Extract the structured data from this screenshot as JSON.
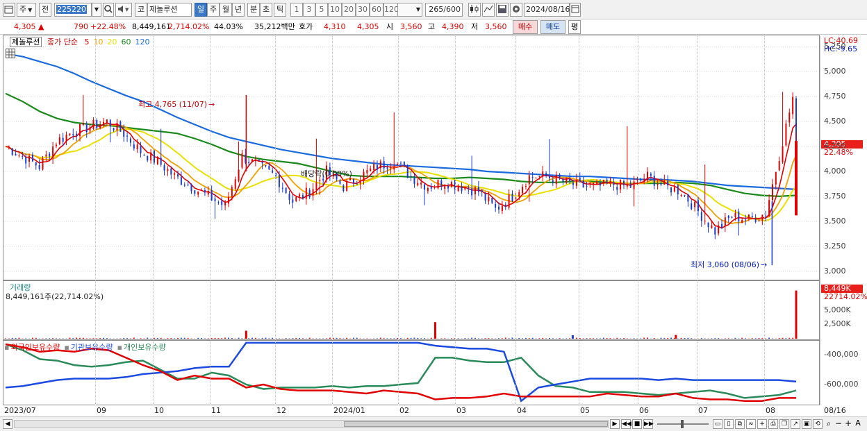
{
  "toolbar": {
    "period_type": "주",
    "prev_label": "전",
    "code_value": "225220",
    "market_label": "코",
    "stock_name": "제놀루션",
    "periods": [
      {
        "label": "일",
        "selected": true
      },
      {
        "label": "주",
        "selected": false
      },
      {
        "label": "월",
        "selected": false
      },
      {
        "label": "년",
        "selected": false
      },
      {
        "label": "분",
        "selected": false
      },
      {
        "label": "초",
        "selected": false
      },
      {
        "label": "틱",
        "selected": false
      }
    ],
    "intervals": [
      "1",
      "3",
      "5",
      "10",
      "20",
      "30",
      "60",
      "120"
    ],
    "count_value": "265",
    "count_total": "/600",
    "date_value": "2024/08/16"
  },
  "quote": {
    "price": "4,305",
    "up_arrow": "▲",
    "change": "790",
    "change_pct": "+22.48%",
    "volume": "8,449,161",
    "volume_ratio": "2,714.02%",
    "turnover": "44.03%",
    "amount": "35,212백만",
    "bid_label": "호가",
    "bid_value": "4,310",
    "ask_value": "4,305",
    "open_label": "시",
    "open_value": "3,560",
    "high_label": "고",
    "high_value": "4,390",
    "low_label": "저",
    "low_value": "3,560",
    "buy_label": "매수",
    "sell_label": "매도",
    "eval_label": "평"
  },
  "price_panel": {
    "stock_label": "제놀루션",
    "ma_type": "종가 단순",
    "ma_periods": [
      {
        "label": "5",
        "color": "#e00000"
      },
      {
        "label": "10",
        "color": "#f0a000"
      },
      {
        "label": "20",
        "color": "#e8e000"
      },
      {
        "label": "60",
        "color": "#1a8a1a"
      },
      {
        "label": "120",
        "color": "#1a6ae0"
      }
    ],
    "lc_label": "LC:40.69",
    "hc_label": "HC:-9.65",
    "price_badge": "4,305",
    "pct_label": "22.48%",
    "high_annotation": "최고 4,765 (11/07)",
    "low_annotation": "최저 3,060 (08/06)",
    "dividend_annotation": "배당락(0.00%)",
    "y_labels": [
      "5,250",
      "5,000",
      "4,750",
      "4,500",
      "4,250",
      "4,000",
      "3,750",
      "3,500",
      "3,250",
      "3,000"
    ]
  },
  "volume_panel": {
    "title": "거래량",
    "value_text": "8,449,161주(22,714.02%)",
    "badge": "8,449K",
    "pct_label": "22714.02%",
    "y_labels": [
      "5,000K",
      "2,500K"
    ]
  },
  "holding_panel": {
    "legend": [
      {
        "label": "외국인보유수량",
        "color": "#e00000"
      },
      {
        "label": "기관보유수량",
        "color": "#1a4ae0"
      },
      {
        "label": "개인보유수량",
        "color": "#2a8a5a"
      }
    ],
    "y_labels": [
      "-400,000",
      "-600,000"
    ]
  },
  "x_axis": {
    "labels": [
      "2023/07",
      "09",
      "10",
      "11",
      "12",
      "2024/01",
      "02",
      "03",
      "04",
      "05",
      "06",
      "07",
      "08",
      "08/16"
    ]
  },
  "chart_data": {
    "type": "candlestick",
    "price_axis": {
      "ylim": [
        2950,
        5300
      ]
    },
    "weekly_close": [
      4250,
      4150,
      4050,
      4300,
      4400,
      4450,
      4500,
      4380,
      4200,
      4100,
      3950,
      3850,
      3750,
      3650,
      4150,
      4050,
      3950,
      3700,
      3800,
      4000,
      3850,
      3950,
      4050,
      4100,
      3950,
      3850,
      3900,
      3850,
      3800,
      3620,
      3750,
      3950,
      3950,
      3900,
      3850,
      3850,
      3870,
      3850,
      3950,
      3850,
      3800,
      3600,
      3400,
      3550,
      3520,
      3580,
      4305
    ],
    "ma120": [
      5180,
      5150,
      5100,
      5050,
      4980,
      4900,
      4830,
      4760,
      4700,
      4620,
      4540,
      4470,
      4400,
      4340,
      4300,
      4260,
      4220,
      4190,
      4160,
      4130,
      4110,
      4090,
      4070,
      4060,
      4050,
      4040,
      4030,
      4020,
      4000,
      3990,
      3980,
      3970,
      3960,
      3950,
      3950,
      3940,
      3930,
      3920,
      3920,
      3910,
      3900,
      3880,
      3860,
      3850,
      3840,
      3830,
      3820
    ],
    "ma60": [
      4780,
      4700,
      4600,
      4530,
      4490,
      4470,
      4460,
      4440,
      4420,
      4400,
      4380,
      4330,
      4270,
      4200,
      4150,
      4120,
      4100,
      4080,
      4040,
      4000,
      3960,
      3950,
      3950,
      3950,
      3940,
      3930,
      3930,
      3940,
      3930,
      3920,
      3900,
      3890,
      3890,
      3900,
      3900,
      3890,
      3880,
      3880,
      3880,
      3890,
      3880,
      3860,
      3820,
      3780,
      3760,
      3750,
      3760
    ],
    "high": {
      "value": 4765,
      "date": "11/07"
    },
    "low": {
      "value": 3060,
      "date": "08/06"
    },
    "volume_spikes_k": [
      {
        "week": 14,
        "value": 1400
      },
      {
        "week": 25,
        "value": 2900
      },
      {
        "week": 33,
        "value": 600
      },
      {
        "week": 39,
        "value": 650
      },
      {
        "week": 47,
        "value": 8449
      }
    ],
    "volume_axis": {
      "ylim": [
        0,
        9500
      ]
    },
    "holding_axis": {
      "ylim": [
        -730000,
        -330000
      ]
    },
    "foreign_holding": [
      -330000,
      -350000,
      -380000,
      -370000,
      -380000,
      -360000,
      -370000,
      -420000,
      -470000,
      -510000,
      -570000,
      -540000,
      -560000,
      -560000,
      -620000,
      -600000,
      -630000,
      -640000,
      -640000,
      -640000,
      -650000,
      -660000,
      -640000,
      -650000,
      -660000,
      -700000,
      -690000,
      -690000,
      -680000,
      -660000,
      -680000,
      -680000,
      -680000,
      -680000,
      -680000,
      -660000,
      -670000,
      -680000,
      -680000,
      -660000,
      -690000,
      -700000,
      -700000,
      -710000,
      -710000,
      -690000,
      -690000
    ],
    "institution_holding": [
      -620000,
      -610000,
      -590000,
      -570000,
      -560000,
      -560000,
      -560000,
      -550000,
      -530000,
      -520000,
      -510000,
      -490000,
      -480000,
      -480000,
      -320000,
      -320000,
      -320000,
      -320000,
      -320000,
      -320000,
      -320000,
      -320000,
      -320000,
      -320000,
      -320000,
      -340000,
      -350000,
      -360000,
      -360000,
      -380000,
      -710000,
      -620000,
      -600000,
      -580000,
      -560000,
      -560000,
      -560000,
      -560000,
      -570000,
      -560000,
      -570000,
      -570000,
      -570000,
      -570000,
      -570000,
      -570000,
      -580000
    ],
    "individual_holding": [
      -330000,
      -370000,
      -430000,
      -440000,
      -470000,
      -480000,
      -470000,
      -450000,
      -440000,
      -500000,
      -560000,
      -560000,
      -520000,
      -540000,
      -600000,
      -630000,
      -620000,
      -620000,
      -620000,
      -610000,
      -620000,
      -610000,
      -610000,
      -600000,
      -590000,
      -420000,
      -420000,
      -440000,
      -450000,
      -450000,
      -420000,
      -540000,
      -610000,
      -620000,
      -650000,
      -650000,
      -650000,
      -660000,
      -670000,
      -660000,
      -650000,
      -640000,
      -660000,
      -690000,
      -680000,
      -670000,
      -640000
    ]
  }
}
